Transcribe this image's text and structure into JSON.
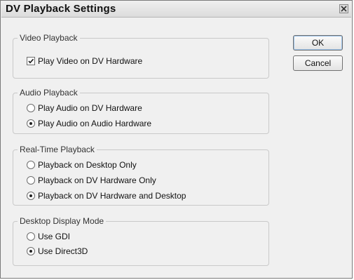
{
  "window": {
    "title": "DV Playback Settings"
  },
  "buttons": {
    "ok": "OK",
    "cancel": "Cancel"
  },
  "video": {
    "legend": "Video Playback",
    "options": [
      {
        "label": "Play Video on DV Hardware",
        "checked": true
      }
    ]
  },
  "audio": {
    "legend": "Audio Playback",
    "options": [
      {
        "label": "Play Audio on DV Hardware",
        "selected": false
      },
      {
        "label": "Play Audio on Audio Hardware",
        "selected": true
      }
    ]
  },
  "realtime": {
    "legend": "Real-Time Playback",
    "options": [
      {
        "label": "Playback on Desktop Only",
        "selected": false
      },
      {
        "label": "Playback on DV Hardware Only",
        "selected": false
      },
      {
        "label": "Playback on DV Hardware and Desktop",
        "selected": true
      }
    ]
  },
  "display": {
    "legend": "Desktop Display Mode",
    "options": [
      {
        "label": "Use GDI",
        "selected": false
      },
      {
        "label": "Use Direct3D",
        "selected": true
      }
    ]
  }
}
